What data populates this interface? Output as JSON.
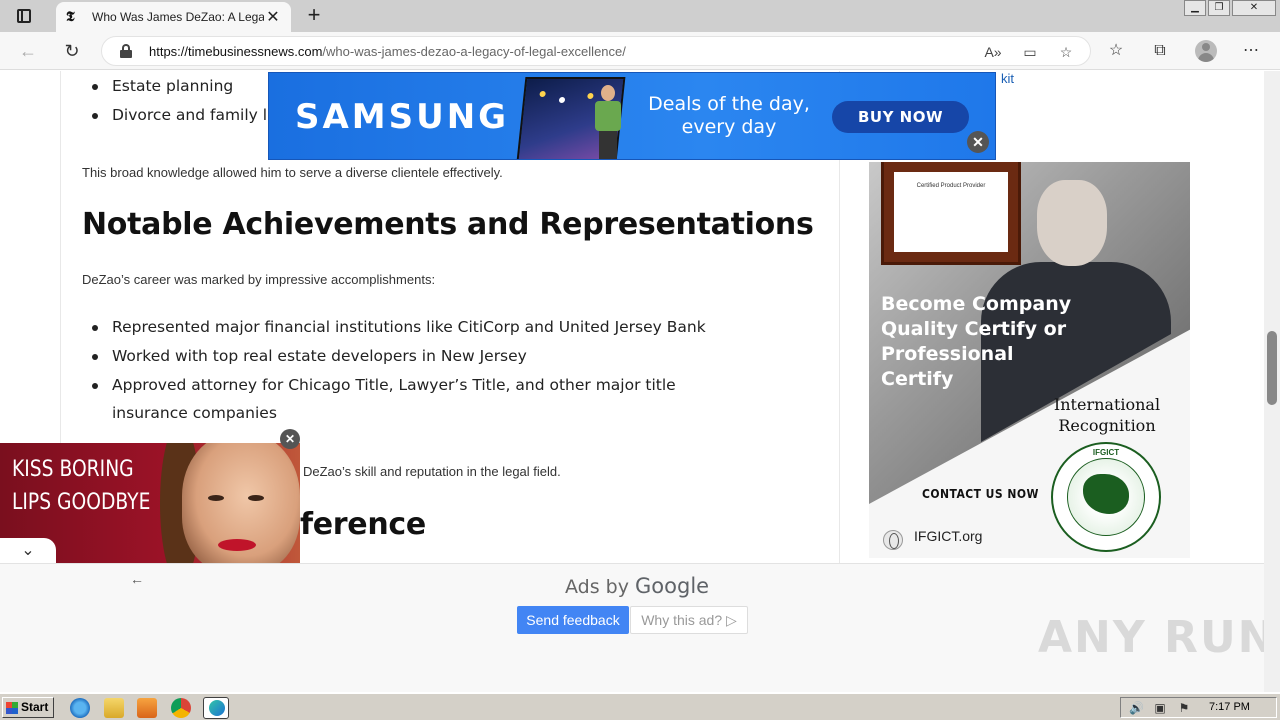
{
  "browser": {
    "tab": {
      "favicon": "𝕿",
      "title": "Who Was James DeZao: A Legacy of Legal Excellence",
      "close": "✕"
    },
    "new_tab": "+",
    "url_host": "https://timebusinessnews.com",
    "url_path": "/who-was-james-dezao-a-legacy-of-legal-excellence/",
    "icons": [
      "tab-actions-icon",
      "back-icon",
      "refresh-icon",
      "lock-icon",
      "read-aloud-icon",
      "immersive-reader-icon",
      "add-favorite-icon",
      "favorites-icon",
      "collections-icon",
      "profile-icon",
      "more-icon"
    ]
  },
  "article": {
    "bullets_top": [
      "Estate planning",
      "Divorce and family law"
    ],
    "para1": "This broad knowledge allowed him to serve a diverse clientele effectively.",
    "heading": "Notable Achievements and Representations",
    "para2": "DeZao’s career was marked by impressive accomplishments:",
    "bullets": [
      "Represented major financial institutions like CitiCorp and United Jersey Bank",
      "Worked with top real estate developers in New Jersey",
      "Approved attorney for Chicago Title, Lawyer’s Title, and other major title insurance companies"
    ],
    "para3_partial": "DeZao’s skill and reputation in the legal field.",
    "heading2_partial": "ference",
    "side_link_partial": "kit"
  },
  "ads": {
    "samsung": {
      "logo": "SAMSUNG",
      "tagline": "Deals of the day, every day",
      "button": "BUY NOW",
      "close": "✕"
    },
    "ifgict": {
      "cert_text": "Certified Product Provider",
      "slogan": "Become Company Quality Certify or Professional Certify",
      "recognition": "International Recognition",
      "seal_title": "IFGICT",
      "contact": "CONTACT US NOW",
      "site": "IFGICT.org"
    },
    "lips": {
      "headline": "KISS BORING LIPS GOODBYE",
      "close": "✕",
      "toggle": "⌄"
    },
    "google": {
      "ads_by": "Ads by",
      "brand": "Google",
      "feedback": "Send feedback",
      "why": "Why this ad? ▷",
      "back": "←"
    }
  },
  "watermark": "ANY RUN",
  "taskbar": {
    "start": "Start",
    "apps": [
      "ie-icon",
      "explorer-icon",
      "media-player-icon",
      "chrome-icon",
      "edge-icon"
    ],
    "clock": "7:17 PM"
  }
}
